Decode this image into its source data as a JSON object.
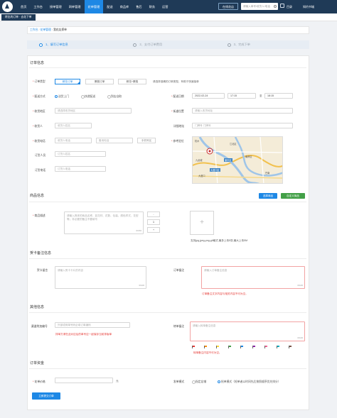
{
  "nav": {
    "items": [
      "首页",
      "工作台",
      "接单管理",
      "网单管理",
      "花单管理",
      "配送",
      "商品库",
      "售后",
      "财务",
      "运营"
    ],
    "active_index": 4,
    "shop_button": "在线花店",
    "search_placeholder": "请输入单号/收货人/电话",
    "menu_label": "目录",
    "user_label": "知约书城"
  },
  "subnav": {
    "tab": "转出的订单 · 去花下单"
  },
  "breadcrumb": {
    "items": [
      "工作台",
      "花单管理",
      "我花店郑单"
    ],
    "sep": "/"
  },
  "steps": [
    {
      "num": "1",
      "label": "填写订单信息",
      "active": true
    },
    {
      "num": "2",
      "label": "支付订单费用",
      "active": false
    },
    {
      "num": "3",
      "label": "完成下单",
      "active": false
    }
  ],
  "order_info": {
    "title": "订单信息",
    "order_type": {
      "label": "订单类型",
      "options": [
        "鲜花订单",
        "蛋糕订单",
        "鲜花+蛋糕"
      ],
      "selected": 0,
      "hint": "请选择准确的订单类型，有助于快速接单"
    },
    "delivery_method": {
      "label": "配送方式",
      "options": [
        "送货上门",
        "快递配送",
        "到店自取"
      ],
      "selected": 0
    },
    "delivery_date": {
      "label": "配送日期",
      "date": "2022-02-24",
      "time_from": "17:15",
      "to_label": "至",
      "time_to": "18:15"
    },
    "receiver_area": {
      "label": "收货地区",
      "placeholder": "请选择收货地区"
    },
    "street": {
      "label": "街道位置",
      "placeholder": "请输入收货地址"
    },
    "receiver": {
      "label": "收货人",
      "placeholder": "收货人姓名"
    },
    "detail_address": {
      "label": "详细地址",
      "placeholder": "门牌号 门牌号"
    },
    "receiver_phone": {
      "label": "收货电话",
      "placeholder": "收货人电话",
      "alt_placeholder": "备用电话",
      "button": "手机号区"
    },
    "ref_location": {
      "label": "参考定位"
    },
    "orderer": {
      "label": "订货人员",
      "placeholder": "订货人姓名"
    },
    "orderer_phone": {
      "label": "订货电话",
      "placeholder": "订货人电话"
    }
  },
  "map": {
    "labels": [
      "杭州",
      "江北区",
      "渝中区",
      "南岸区",
      "大渡口区",
      "大渡口",
      "九龙坡",
      "巴南"
    ]
  },
  "product_info": {
    "title": "商品信息",
    "btn_select": "选择商品",
    "btn_custom": "自定义商品",
    "desc_label": "商品描述",
    "desc_placeholder": "请输入具体的商品名称，如花材、花数、包装、颜色样式、花型等；非必要的备注不要填写",
    "desc_count": "0/150",
    "qty": "1",
    "qty_minus": "-",
    "qty_plus": "+",
    "upload_plus": "+",
    "upload_hint": "支持jpg,jpeg,png,gif格式,最多上传5张,最大上传5M"
  },
  "card_info": {
    "title": "贺卡备注信息",
    "card_label": "贺卡留言",
    "card_placeholder": "请输入贺卡卡片的内容",
    "card_count": "0/100",
    "order_note_label": "订单备注",
    "order_note_placeholder": "请输入订单备注信息",
    "order_note_count": "0/100",
    "order_note_error": "订单备注文字内容与相关内容不可为空。"
  },
  "other_info": {
    "title": "其他信息",
    "channel_label": "渠道附加编号",
    "channel_placeholder": "外部或网单号码必填订单编码",
    "channel_error": "排单方请在此对应后的单号应一起保存当前排版单",
    "transfer_label": "转单备注",
    "transfer_placeholder": "请输入转单备注信息",
    "transfer_count": "0/100",
    "transfer_error": "转单备注内容不可为空。",
    "flag_colors": [
      "#e53935",
      "#fb8c00",
      "#fdd835",
      "#43a047",
      "#1e88e5",
      "#8e24aa",
      "#f06292",
      "#00acc1",
      "#795548"
    ]
  },
  "payment": {
    "title": "订单资金",
    "price_label": "花单价格",
    "price_unit": "元",
    "mode_label": "发单模式",
    "mode_options": [
      "指定店铺",
      "抢单模式（抢单者以时间先后按照顺序优先排分）"
    ],
    "mode_selected": 1
  },
  "submit": {
    "label": "立即提交订单"
  },
  "colors": {
    "brand": "#1f3a57",
    "accent": "#1e88e5",
    "green": "#43a047",
    "error": "#e53935"
  }
}
